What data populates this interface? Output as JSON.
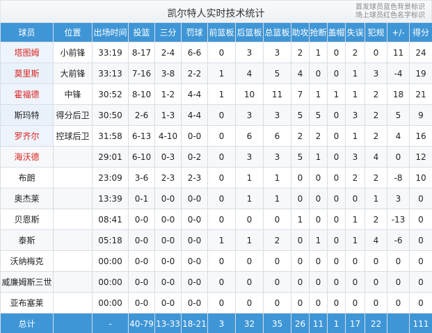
{
  "header": {
    "title": "凯尔特人实时技术统计",
    "note_line1": "首发球员蓝色背景标识",
    "note_line2": "场上球员红色名字标识"
  },
  "columns": [
    "球员",
    "位置",
    "出场时间",
    "投篮",
    "三分",
    "罚球",
    "前篮板",
    "后篮板",
    "总篮板",
    "助攻",
    "抢断",
    "盖帽",
    "失误",
    "犯规",
    "+/-",
    "得分"
  ],
  "rows": [
    {
      "cells": [
        "塔图姆",
        "小前锋",
        "33:19",
        "8-17",
        "2-4",
        "6-6",
        "0",
        "3",
        "3",
        "2",
        "1",
        "0",
        "2",
        "0",
        "11",
        "24"
      ],
      "on_court": true,
      "starter": true
    },
    {
      "cells": [
        "莫里斯",
        "大前锋",
        "33:13",
        "7-16",
        "3-8",
        "2-2",
        "1",
        "4",
        "5",
        "4",
        "0",
        "0",
        "1",
        "3",
        "-4",
        "19"
      ],
      "on_court": true,
      "starter": true
    },
    {
      "cells": [
        "霍福德",
        "中锋",
        "30:52",
        "8-10",
        "1-2",
        "4-4",
        "1",
        "10",
        "11",
        "7",
        "1",
        "1",
        "1",
        "2",
        "18",
        "21"
      ],
      "on_court": true,
      "starter": true
    },
    {
      "cells": [
        "斯玛特",
        "得分后卫",
        "30:50",
        "2-6",
        "1-3",
        "4-4",
        "0",
        "3",
        "3",
        "5",
        "5",
        "0",
        "3",
        "2",
        "5",
        "9"
      ],
      "on_court": false,
      "starter": true
    },
    {
      "cells": [
        "罗齐尔",
        "控球后卫",
        "31:58",
        "6-13",
        "4-10",
        "0-0",
        "0",
        "6",
        "6",
        "2",
        "2",
        "0",
        "1",
        "2",
        "4",
        "16"
      ],
      "on_court": true,
      "starter": true
    },
    {
      "cells": [
        "海沃德",
        "",
        "29:01",
        "6-10",
        "0-3",
        "0-2",
        "0",
        "3",
        "3",
        "5",
        "1",
        "0",
        "3",
        "4",
        "0",
        "12"
      ],
      "on_court": true,
      "starter": false
    },
    {
      "cells": [
        "布朗",
        "",
        "23:09",
        "3-6",
        "2-3",
        "2-3",
        "0",
        "1",
        "1",
        "0",
        "0",
        "0",
        "2",
        "2",
        "-8",
        "10"
      ],
      "on_court": false,
      "starter": false
    },
    {
      "cells": [
        "奥杰莱",
        "",
        "13:39",
        "0-1",
        "0-0",
        "0-0",
        "0",
        "1",
        "1",
        "0",
        "0",
        "0",
        "0",
        "1",
        "3",
        "0"
      ],
      "on_court": false,
      "starter": false
    },
    {
      "cells": [
        "贝恩斯",
        "",
        "08:41",
        "0-0",
        "0-0",
        "0-0",
        "0",
        "0",
        "0",
        "1",
        "0",
        "0",
        "1",
        "2",
        "-13",
        "0"
      ],
      "on_court": false,
      "starter": false
    },
    {
      "cells": [
        "泰斯",
        "",
        "05:18",
        "0-0",
        "0-0",
        "0-0",
        "1",
        "1",
        "2",
        "0",
        "1",
        "0",
        "1",
        "4",
        "-6",
        "0"
      ],
      "on_court": false,
      "starter": false
    },
    {
      "cells": [
        "沃纳梅克",
        "",
        "00:00",
        "0-0",
        "0-0",
        "0-0",
        "0",
        "0",
        "0",
        "0",
        "0",
        "0",
        "0",
        "0",
        "0",
        "0"
      ],
      "on_court": false,
      "starter": false
    },
    {
      "cells": [
        "威廉姆斯三世",
        "",
        "00:00",
        "0-0",
        "0-0",
        "0-0",
        "0",
        "0",
        "0",
        "0",
        "0",
        "0",
        "0",
        "0",
        "0",
        "0"
      ],
      "on_court": false,
      "starter": false
    },
    {
      "cells": [
        "亚布塞莱",
        "",
        "00:00",
        "0-0",
        "0-0",
        "0-0",
        "0",
        "0",
        "0",
        "0",
        "0",
        "0",
        "0",
        "0",
        "0",
        "0"
      ],
      "on_court": false,
      "starter": false
    }
  ],
  "totals": [
    "总计",
    "",
    "-",
    "40-79",
    "13-33",
    "18-21",
    "3",
    "32",
    "35",
    "26",
    "11",
    "1",
    "17",
    "22",
    "",
    "111"
  ],
  "colors": {
    "header_bg": "#3f96d6",
    "on_court_name": "#d9241f",
    "starter_bg": "#eef4fb"
  }
}
